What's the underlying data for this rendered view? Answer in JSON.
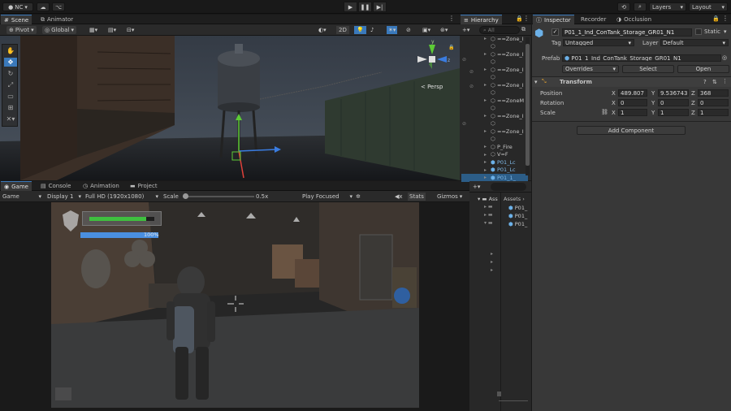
{
  "topbar": {
    "account_label": "NC",
    "layers_label": "Layers",
    "layout_label": "Layout"
  },
  "scene": {
    "tabs": [
      {
        "label": "Scene"
      },
      {
        "label": "Animator"
      }
    ],
    "pivot_label": "Pivot",
    "global_label": "Global",
    "mode_2d_label": "2D",
    "gizmo_axis_y": "y",
    "gizmo_axis_z": "z",
    "persp_label": "< Persp"
  },
  "game": {
    "tabs": [
      {
        "label": "Game"
      },
      {
        "label": "Console"
      },
      {
        "label": "Animation"
      },
      {
        "label": "Project"
      }
    ],
    "display_target": "Game",
    "display_label": "Display 1",
    "resolution": "Full HD (1920x1080)",
    "scale_label": "Scale",
    "scale_value": "0.5x",
    "play_focused": "Play Focused",
    "stats_label": "Stats",
    "gizmos_label": "Gizmos",
    "health_fraction": 0.88,
    "stamina_fraction": 1.0,
    "stamina_text": "100%"
  },
  "hierarchy": {
    "tab_label": "Hierarchy",
    "search_placeholder": "All",
    "items": [
      {
        "label": "==Zone_I"
      },
      {
        "label": ""
      },
      {
        "label": "==Zone_I"
      },
      {
        "label": ""
      },
      {
        "label": "==Zone_I"
      },
      {
        "label": ""
      },
      {
        "label": "==Zone_I"
      },
      {
        "label": ""
      },
      {
        "label": "==ZoneM"
      },
      {
        "label": ""
      },
      {
        "label": "==Zone_I"
      },
      {
        "label": ""
      },
      {
        "label": "==Zone_I"
      },
      {
        "label": ""
      },
      {
        "label": "P_Fire"
      },
      {
        "label": "V=F"
      },
      {
        "label": "P01_Lc"
      },
      {
        "label": "P01_Lc"
      },
      {
        "label": "P01_1_"
      }
    ]
  },
  "project": {
    "assets_label": "Assets",
    "tree_root": "Ass",
    "files": [
      {
        "label": "P01_"
      },
      {
        "label": "P01_"
      },
      {
        "label": "P01_"
      }
    ]
  },
  "inspector": {
    "tabs": [
      {
        "label": "Inspector"
      },
      {
        "label": "Recorder"
      },
      {
        "label": "Occlusion"
      }
    ],
    "object_name": "P01_1_Ind_ConTank_Storage_GR01_N1",
    "static_label": "Static",
    "tag_label": "Tag",
    "tag_value": "Untagged",
    "layer_label": "Layer",
    "layer_value": "Default",
    "prefab_label": "Prefab",
    "prefab_value": "P01_1_Ind_ConTank_Storage_GR01_N1",
    "overrides_label": "Overrides",
    "select_label": "Select",
    "open_label": "Open",
    "transform_label": "Transform",
    "position_label": "Position",
    "rotation_label": "Rotation",
    "scale_label": "Scale",
    "axis_x": "X",
    "axis_y": "Y",
    "axis_z": "Z",
    "position": {
      "x": "489.807",
      "y": "9.536743",
      "z": "368"
    },
    "rotation": {
      "x": "0",
      "y": "0",
      "z": "0"
    },
    "scale": {
      "x": "1",
      "y": "1",
      "z": "1"
    },
    "add_component": "Add Component"
  },
  "colors": {
    "accent": "#3a79bb",
    "editor_bg": "#383838",
    "gizmo_y": "#5ccb35",
    "gizmo_x": "#e0413a",
    "gizmo_z": "#3a7ce0",
    "health": "#3fbf3f",
    "stamina": "#4a8fe0"
  }
}
